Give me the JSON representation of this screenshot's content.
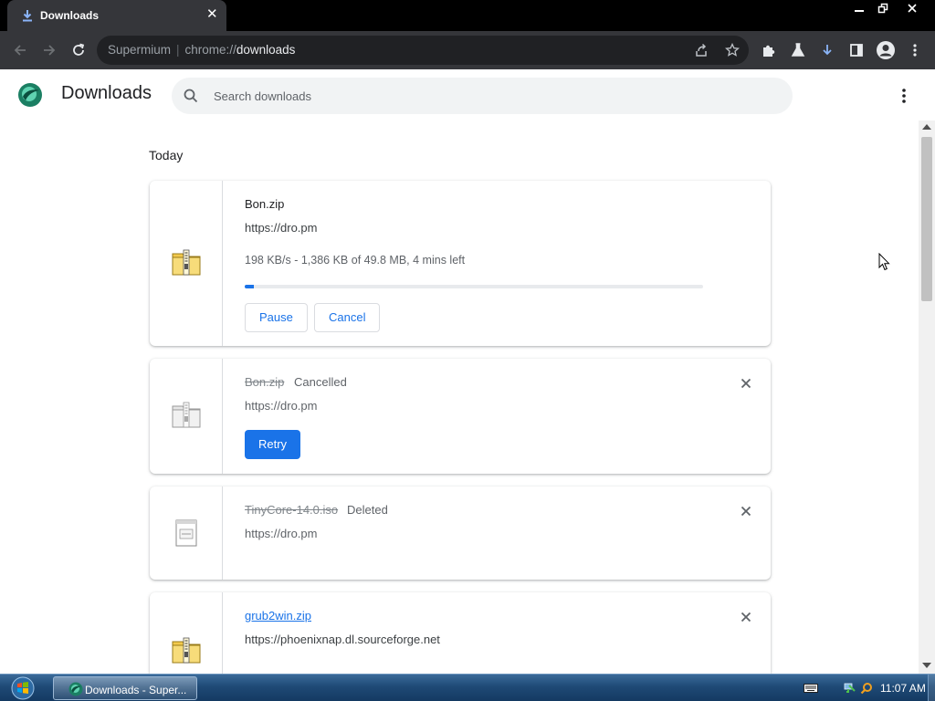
{
  "browser": {
    "tab_title": "Downloads",
    "omnibox_brand": "Supermium",
    "url_scheme": "chrome://",
    "url_path": "downloads"
  },
  "page": {
    "title": "Downloads",
    "search_placeholder": "Search downloads",
    "section_today": "Today"
  },
  "downloads": [
    {
      "name": "Bon.zip",
      "url": "https://dro.pm",
      "progress_text": "198 KB/s - 1,386 KB of 49.8 MB, 4 mins left",
      "progress_percent": 2,
      "pause_label": "Pause",
      "cancel_label": "Cancel",
      "icon": "zip-folder-icon"
    },
    {
      "name": "Bon.zip",
      "status": "Cancelled",
      "url": "https://dro.pm",
      "retry_label": "Retry",
      "icon": "zip-folder-icon"
    },
    {
      "name": "TinyCore-14.0.iso",
      "status": "Deleted",
      "url": "https://dro.pm",
      "icon": "file-icon"
    },
    {
      "name": "grub2win.zip",
      "url": "https://phoenixnap.dl.sourceforge.net",
      "icon": "zip-folder-icon"
    }
  ],
  "taskbar": {
    "task_label": "Downloads - Super...",
    "clock": "11:07 AM"
  },
  "colors": {
    "accent": "#1a73e8",
    "tabbar": "#000000",
    "toolbar": "#35363a",
    "omnibox": "#202124"
  }
}
